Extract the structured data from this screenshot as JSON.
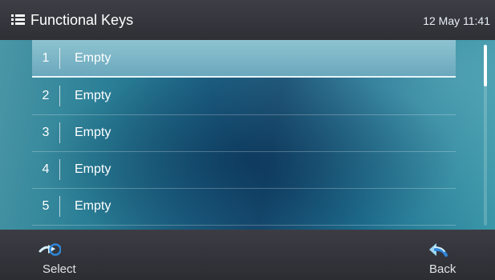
{
  "header": {
    "title": "Functional Keys",
    "datetime": "12 May 11:41",
    "icon": "menu-list-icon"
  },
  "list": {
    "items": [
      {
        "number": "1",
        "label": "Empty",
        "selected": true
      },
      {
        "number": "2",
        "label": "Empty",
        "selected": false
      },
      {
        "number": "3",
        "label": "Empty",
        "selected": false
      },
      {
        "number": "4",
        "label": "Empty",
        "selected": false
      },
      {
        "number": "5",
        "label": "Empty",
        "selected": false
      }
    ]
  },
  "softkeys": {
    "select": {
      "label": "Select",
      "icon": "select-arrow-icon"
    },
    "back": {
      "label": "Back",
      "icon": "back-arrow-icon"
    }
  },
  "colors": {
    "accent_blue": "#2e86d8",
    "selected_row": "#7fb8c8",
    "bar_background": "#35363c"
  }
}
